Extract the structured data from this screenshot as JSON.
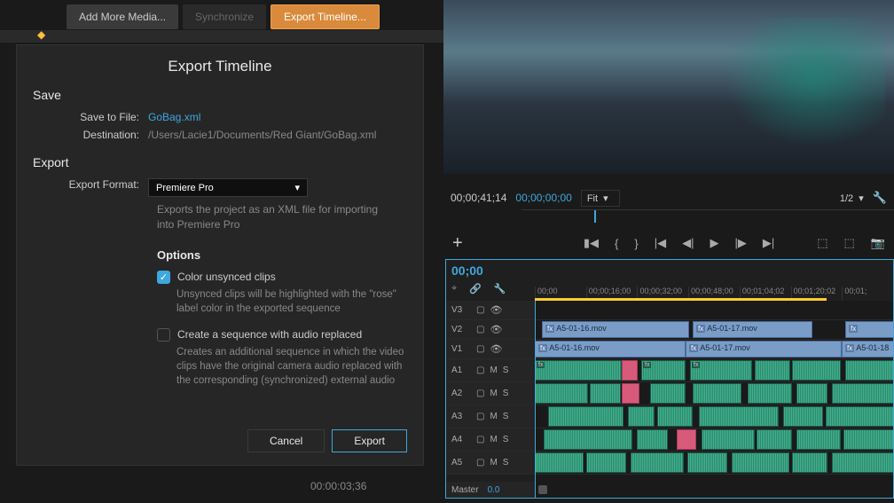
{
  "toolbar": {
    "add_media": "Add More Media...",
    "synchronize": "Synchronize",
    "export_timeline": "Export Timeline..."
  },
  "modal": {
    "title": "Export Timeline",
    "save_h": "Save",
    "save_to_file_label": "Save to File:",
    "save_to_file_value": "GoBag.xml",
    "destination_label": "Destination:",
    "destination_value": "/Users/Lacie1/Documents/Red Giant/GoBag.xml",
    "export_h": "Export",
    "format_label": "Export Format:",
    "format_value": "Premiere Pro",
    "format_desc": "Exports the project as an XML file for importing into Premiere Pro",
    "options_h": "Options",
    "opt1_label": "Color unsynced clips",
    "opt1_desc": "Unsynced clips will be highlighted with the \"rose\" label color in the exported sequence",
    "opt2_label": "Create a sequence with audio replaced",
    "opt2_desc": "Creates an additional sequence in which the video clips have the original camera audio replaced with the corresponding (synchronized) external audio",
    "cancel": "Cancel",
    "export": "Export"
  },
  "bottom_tc": "00:00:03;36",
  "preview": {
    "tc_left": "00;00;41;14",
    "tc_right": "00;00;00;00",
    "fit_label": "Fit",
    "ratio": "1/2"
  },
  "timeline": {
    "tc": "00;00",
    "ticks": [
      "00;00",
      "00;00;16;00",
      "00;00;32;00",
      "00;00;48;00",
      "00;01;04;02",
      "00;01;20;02",
      "00;01;"
    ],
    "video_tracks": [
      "V3",
      "V2",
      "V1"
    ],
    "audio_tracks": [
      "A1",
      "A2",
      "A3",
      "A4",
      "A5"
    ],
    "master_label": "Master",
    "master_value": "0.0",
    "clips": {
      "v2a": "A5-01-16.mov",
      "v2b": "A5-01-17.mov",
      "v1a": "A5-01-16.mov",
      "v1b": "A5-01-17.mov",
      "v1c": "A5-01-18"
    }
  },
  "track_labels": {
    "mute": "M",
    "solo": "S",
    "fx": "fx"
  }
}
